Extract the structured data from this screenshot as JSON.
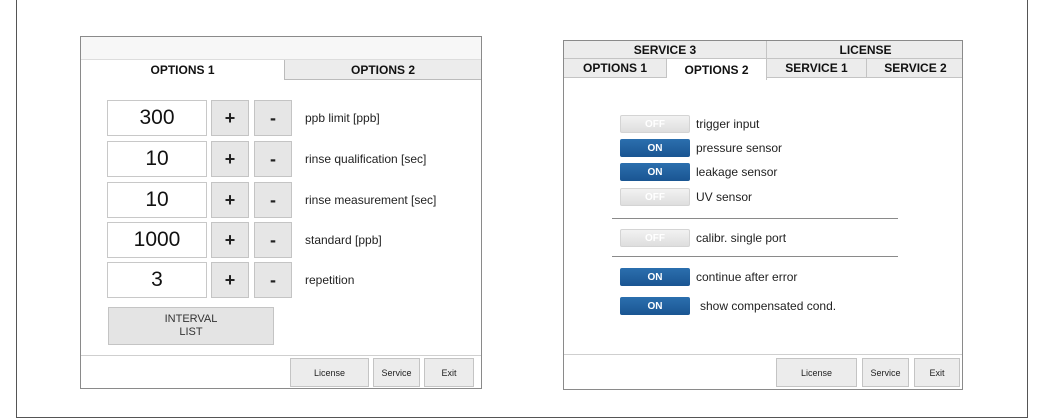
{
  "left": {
    "tabs": [
      "OPTIONS 1",
      "OPTIONS 2"
    ],
    "rows": [
      {
        "value": "300",
        "plus": "+",
        "minus": "-",
        "label": "ppb limit [ppb]"
      },
      {
        "value": "10",
        "plus": "+",
        "minus": "-",
        "label": "rinse qualification [sec]"
      },
      {
        "value": "10",
        "plus": "+",
        "minus": "-",
        "label": "rinse measurement [sec]"
      },
      {
        "value": "1000",
        "plus": "+",
        "minus": "-",
        "label": "standard [ppb]"
      },
      {
        "value": "3",
        "plus": "+",
        "minus": "-",
        "label": "repetition"
      }
    ],
    "interval_button": {
      "line1": "INTERVAL",
      "line2": "LIST"
    },
    "footer": {
      "license": "License",
      "service": "Service",
      "exit": "Exit"
    }
  },
  "right": {
    "tabs_top": [
      "SERVICE 3",
      "LICENSE"
    ],
    "tabs_bottom": [
      "OPTIONS 1",
      "OPTIONS 2",
      "SERVICE 1",
      "SERVICE 2"
    ],
    "toggles": [
      {
        "state": "OFF",
        "label": "trigger input"
      },
      {
        "state": "ON",
        "label": "pressure sensor"
      },
      {
        "state": "ON",
        "label": "leakage sensor"
      },
      {
        "state": "OFF",
        "label": "UV sensor"
      },
      {
        "state": "OFF",
        "label": "calibr. single port"
      },
      {
        "state": "ON",
        "label": "continue after error"
      },
      {
        "state": "ON",
        "label": "show compensated cond."
      }
    ],
    "footer": {
      "license": "License",
      "service": "Service",
      "exit": "Exit"
    }
  },
  "colors": {
    "toggle_on": "#1f62a3",
    "toggle_off": "#e6e6e6",
    "button_bg": "#e6e6e6"
  }
}
